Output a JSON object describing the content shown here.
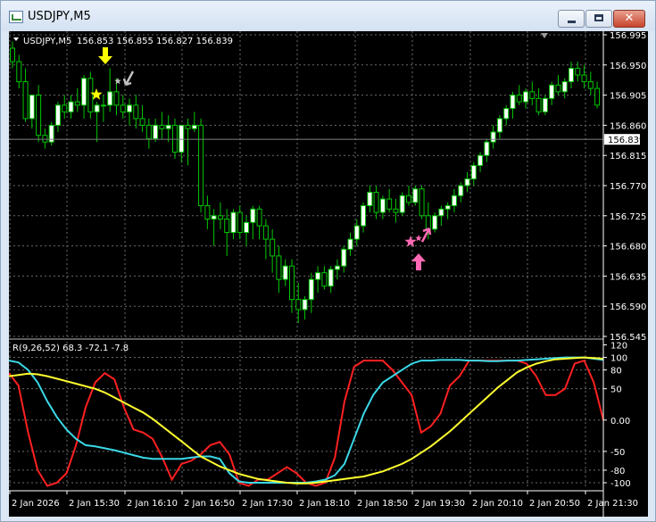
{
  "window": {
    "title": "USDJPY,M5",
    "icon": "chart-window-icon",
    "buttons": {
      "minimize": "minimize-icon",
      "maximize": "maximize-icon",
      "close": "close-icon"
    }
  },
  "colors": {
    "background": "#000000",
    "grid": "#6b6b6b",
    "bull_candle": "#ffffff",
    "bear_candle": "#000000",
    "wick": "#00c800",
    "axis_text": "#ffffff",
    "price_line": "#808080",
    "signal_sell": "#ffff00",
    "signal_sell_exit": "#c0c0c0",
    "signal_buy": "#ff69b4",
    "series_red": "#ff2020",
    "series_cyan": "#3ad8e6",
    "series_yellow": "#ffff30"
  },
  "main_chart": {
    "symbol_line": {
      "symbol": "USDJPY,M5",
      "ohlc": "156.853 156.855 156.827 156.839"
    },
    "price_ticks": [
      "156.995",
      "156.950",
      "156.905",
      "156.860",
      "156.815",
      "156.770",
      "156.725",
      "156.680",
      "156.635",
      "156.590",
      "156.545"
    ],
    "current_price": "156.839",
    "signals": [
      {
        "type": "sell-arrow",
        "icon": "arrow-down-icon",
        "color": "#ffff00"
      },
      {
        "type": "sell-star",
        "icon": "star-icon",
        "color": "#ffff00"
      },
      {
        "type": "exit-arrow",
        "icon": "arrow-down-left-icon",
        "color": "#c0c0c0"
      },
      {
        "type": "buy-arrow",
        "icon": "arrow-up-icon",
        "color": "#ff69b4"
      },
      {
        "type": "buy-star",
        "icon": "star-icon",
        "color": "#ff69b4"
      },
      {
        "type": "exit-arrow",
        "icon": "arrow-up-right-icon",
        "color": "#ff69b4"
      }
    ]
  },
  "chart_data": [
    {
      "type": "candlestick",
      "title": "USDJPY,M5",
      "ylim": [
        156.545,
        156.995
      ],
      "x_tick_labels": [
        "2 Jan 2026",
        "2 Jan 15:30",
        "2 Jan 16:10",
        "2 Jan 16:50",
        "2 Jan 17:30",
        "2 Jan 18:10",
        "2 Jan 18:50",
        "2 Jan 19:30",
        "2 Jan 20:10",
        "2 Jan 20:50",
        "2 Jan 21:30"
      ],
      "candles": [
        [
          156.975,
          156.985,
          156.945,
          156.955
        ],
        [
          156.955,
          156.965,
          156.915,
          156.925
        ],
        [
          156.925,
          156.945,
          156.865,
          156.87
        ],
        [
          156.87,
          156.905,
          156.855,
          156.905
        ],
        [
          156.905,
          156.92,
          156.835,
          156.845
        ],
        [
          156.845,
          156.855,
          156.825,
          156.835
        ],
        [
          156.835,
          156.865,
          156.83,
          156.86
        ],
        [
          156.86,
          156.895,
          156.85,
          156.89
        ],
        [
          156.89,
          156.905,
          156.87,
          156.88
        ],
        [
          156.88,
          156.905,
          156.87,
          156.895
        ],
        [
          156.895,
          156.915,
          156.88,
          156.89
        ],
        [
          156.89,
          156.935,
          156.87,
          156.93
        ],
        [
          156.93,
          156.94,
          156.87,
          156.88
        ],
        [
          156.88,
          156.895,
          156.835,
          156.89
        ],
        [
          156.89,
          156.905,
          156.865,
          156.89
        ],
        [
          156.89,
          156.945,
          156.88,
          156.91
        ],
        [
          156.91,
          156.93,
          156.875,
          156.89
        ],
        [
          156.89,
          156.905,
          156.87,
          156.88
        ],
        [
          156.88,
          156.9,
          156.86,
          156.89
        ],
        [
          156.89,
          156.905,
          156.855,
          156.87
        ],
        [
          156.87,
          156.89,
          156.85,
          156.86
        ],
        [
          156.86,
          156.87,
          156.825,
          156.84
        ],
        [
          156.84,
          156.87,
          156.835,
          156.86
        ],
        [
          156.86,
          156.88,
          156.84,
          156.855
        ],
        [
          156.855,
          156.875,
          156.835,
          156.86
        ],
        [
          156.86,
          156.87,
          156.81,
          156.82
        ],
        [
          156.82,
          156.86,
          156.805,
          156.86
        ],
        [
          156.86,
          156.87,
          156.8,
          156.855
        ],
        [
          156.855,
          156.88,
          156.85,
          156.86
        ],
        [
          156.86,
          156.87,
          156.73,
          156.74
        ],
        [
          156.74,
          156.755,
          156.705,
          156.72
        ],
        [
          156.72,
          156.735,
          156.68,
          156.725
        ],
        [
          156.725,
          156.745,
          156.705,
          156.72
        ],
        [
          156.72,
          156.735,
          156.665,
          156.7
        ],
        [
          156.7,
          156.735,
          156.69,
          156.73
        ],
        [
          156.73,
          156.74,
          156.69,
          156.7
        ],
        [
          156.7,
          156.725,
          156.68,
          156.715
        ],
        [
          156.715,
          156.74,
          156.69,
          156.735
        ],
        [
          156.735,
          156.74,
          156.69,
          156.71
        ],
        [
          156.71,
          156.72,
          156.66,
          156.69
        ],
        [
          156.69,
          156.705,
          156.64,
          156.665
        ],
        [
          156.665,
          156.68,
          156.61,
          156.63
        ],
        [
          156.63,
          156.66,
          156.62,
          156.65
        ],
        [
          156.65,
          156.66,
          156.58,
          156.6
        ],
        [
          156.6,
          156.625,
          156.565,
          156.585
        ],
        [
          156.585,
          156.605,
          156.57,
          156.6
        ],
        [
          156.6,
          156.64,
          156.58,
          156.63
        ],
        [
          156.63,
          156.65,
          156.61,
          156.64
        ],
        [
          156.64,
          156.65,
          156.615,
          156.62
        ],
        [
          156.62,
          156.65,
          156.61,
          156.645
        ],
        [
          156.645,
          156.66,
          156.63,
          156.65
        ],
        [
          156.65,
          156.68,
          156.64,
          156.675
        ],
        [
          156.675,
          156.7,
          156.665,
          156.69
        ],
        [
          156.69,
          156.72,
          156.68,
          156.71
        ],
        [
          156.71,
          156.745,
          156.7,
          156.74
        ],
        [
          156.74,
          156.77,
          156.73,
          156.76
        ],
        [
          156.76,
          156.77,
          156.72,
          156.73
        ],
        [
          156.73,
          156.755,
          156.72,
          156.75
        ],
        [
          156.75,
          156.765,
          156.73,
          156.735
        ],
        [
          156.735,
          156.75,
          156.715,
          156.73
        ],
        [
          156.73,
          156.76,
          156.725,
          156.755
        ],
        [
          156.755,
          156.77,
          156.74,
          156.745
        ],
        [
          156.745,
          156.77,
          156.74,
          156.765
        ],
        [
          156.765,
          156.77,
          156.72,
          156.725
        ],
        [
          156.725,
          156.745,
          156.69,
          156.705
        ],
        [
          156.705,
          156.73,
          156.7,
          156.725
        ],
        [
          156.725,
          156.74,
          156.71,
          156.735
        ],
        [
          156.735,
          156.745,
          156.72,
          156.74
        ],
        [
          156.74,
          156.765,
          156.73,
          156.755
        ],
        [
          156.755,
          156.775,
          156.745,
          156.77
        ],
        [
          156.77,
          156.79,
          156.76,
          156.78
        ],
        [
          156.78,
          156.805,
          156.77,
          156.8
        ],
        [
          156.8,
          156.82,
          156.79,
          156.815
        ],
        [
          156.815,
          156.84,
          156.805,
          156.835
        ],
        [
          156.835,
          156.86,
          156.825,
          156.85
        ],
        [
          156.85,
          156.875,
          156.84,
          156.87
        ],
        [
          156.87,
          156.89,
          156.86,
          156.885
        ],
        [
          156.885,
          156.91,
          156.87,
          156.905
        ],
        [
          156.905,
          156.92,
          156.89,
          156.895
        ],
        [
          156.895,
          156.915,
          156.885,
          156.91
        ],
        [
          156.91,
          156.925,
          156.89,
          156.9
        ],
        [
          156.9,
          156.915,
          156.875,
          156.88
        ],
        [
          156.88,
          156.905,
          156.875,
          156.9
        ],
        [
          156.9,
          156.925,
          156.89,
          156.92
        ],
        [
          156.92,
          156.935,
          156.905,
          156.91
        ],
        [
          156.91,
          156.93,
          156.9,
          156.925
        ],
        [
          156.925,
          156.955,
          156.915,
          156.945
        ],
        [
          156.945,
          156.955,
          156.925,
          156.935
        ],
        [
          156.935,
          156.95,
          156.915,
          156.925
        ],
        [
          156.925,
          156.94,
          156.905,
          156.915
        ],
        [
          156.915,
          156.925,
          156.885,
          156.89
        ]
      ]
    },
    {
      "type": "line",
      "title": "R(9,26,52) 68.3 -72.1 -7.8",
      "ylim": [
        -110,
        125
      ],
      "y_tick_labels": [
        "120",
        "100",
        "80",
        "50",
        "0.00",
        "-50",
        "-80",
        "-100"
      ],
      "y_tick_values": [
        120,
        100,
        80,
        50,
        0,
        -50,
        -80,
        -100
      ],
      "x_tick_labels": [
        "2 Jan 2026",
        "2 Jan 15:30",
        "2 Jan 16:10",
        "2 Jan 16:50",
        "2 Jan 17:30",
        "2 Jan 18:10",
        "2 Jan 18:50",
        "2 Jan 19:30",
        "2 Jan 20:10",
        "2 Jan 20:50",
        "2 Jan 21:30"
      ],
      "series": [
        {
          "color": "#ff2020",
          "values": [
            75,
            55,
            -20,
            -80,
            -105,
            -100,
            -85,
            -40,
            20,
            60,
            75,
            65,
            20,
            -15,
            -20,
            -30,
            -60,
            -95,
            -70,
            -65,
            -55,
            -40,
            -35,
            -55,
            -100,
            -105,
            -95,
            -95,
            -85,
            -75,
            -85,
            -100,
            -105,
            -100,
            -60,
            30,
            85,
            95,
            95,
            95,
            80,
            60,
            40,
            -20,
            -10,
            10,
            55,
            70,
            95,
            95,
            95,
            95,
            95,
            95,
            90,
            70,
            40,
            40,
            50,
            90,
            95,
            60,
            0
          ]
        },
        {
          "color": "#3ad8e6",
          "values": [
            95,
            92,
            80,
            60,
            30,
            5,
            -15,
            -30,
            -40,
            -42,
            -45,
            -48,
            -52,
            -56,
            -60,
            -62,
            -62,
            -62,
            -62,
            -60,
            -58,
            -58,
            -62,
            -85,
            -98,
            -100,
            -100,
            -100,
            -100,
            -100,
            -100,
            -100,
            -98,
            -95,
            -88,
            -70,
            -30,
            10,
            40,
            60,
            70,
            80,
            90,
            95,
            95,
            96,
            96,
            96,
            95,
            95,
            94,
            94,
            95,
            95,
            96,
            97,
            98,
            99,
            100,
            100,
            100,
            98,
            96
          ]
        },
        {
          "color": "#ffff30",
          "values": [
            70,
            72,
            74,
            73,
            70,
            66,
            62,
            58,
            54,
            50,
            44,
            36,
            28,
            20,
            12,
            2,
            -10,
            -22,
            -34,
            -46,
            -58,
            -66,
            -74,
            -80,
            -86,
            -90,
            -94,
            -96,
            -98,
            -100,
            -101,
            -101,
            -100,
            -98,
            -96,
            -94,
            -92,
            -90,
            -86,
            -82,
            -76,
            -70,
            -62,
            -52,
            -42,
            -30,
            -18,
            -4,
            10,
            24,
            38,
            52,
            64,
            76,
            84,
            90,
            94,
            97,
            98,
            99,
            100,
            99,
            98
          ]
        }
      ]
    }
  ]
}
